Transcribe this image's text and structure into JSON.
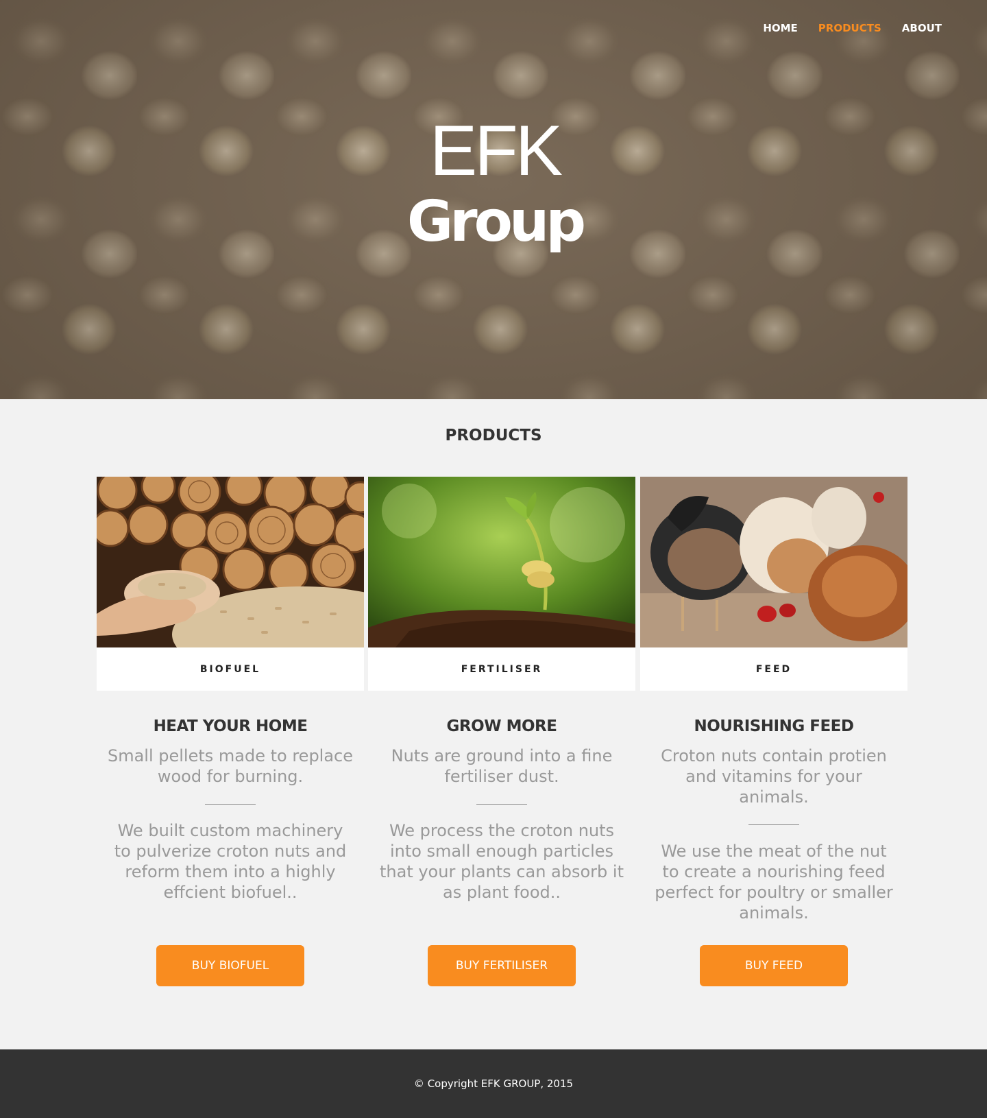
{
  "nav": {
    "items": [
      {
        "label": "HOME"
      },
      {
        "label": "PRODUCTS",
        "active": true
      },
      {
        "label": "ABOUT"
      }
    ]
  },
  "hero": {
    "logo_line1": "EFK",
    "logo_line2": "Group"
  },
  "products": {
    "title": "PRODUCTS",
    "columns": [
      {
        "label": "BIOFUEL",
        "heading": "HEAT YOUR HOME",
        "subtitle": "Small pellets made to replace wood for burning.",
        "body": "We built custom machinery to pulverize croton nuts and reform them into a highly effcient biofuel..",
        "button": "BUY BIOFUEL"
      },
      {
        "label": "FERTILISER",
        "heading": "GROW MORE",
        "subtitle": "Nuts are ground into a fine fertiliser dust.",
        "body": "We process the croton nuts into small enough particles that your plants can absorb it as plant food..",
        "button": "BUY FERTILISER"
      },
      {
        "label": "FEED",
        "heading": "NOURISHING FEED",
        "subtitle": "Croton nuts contain protien and vitamins for your animals.",
        "body": "We use the meat of the nut to create a nourishing feed perfect for poultry or smaller animals.",
        "button": "BUY FEED"
      }
    ]
  },
  "footer": {
    "copyright": "© Copyright EFK GROUP, 2015"
  },
  "colors": {
    "accent": "#f98c1f",
    "footer_bg": "#333333",
    "page_bg": "#f2f2f2"
  }
}
